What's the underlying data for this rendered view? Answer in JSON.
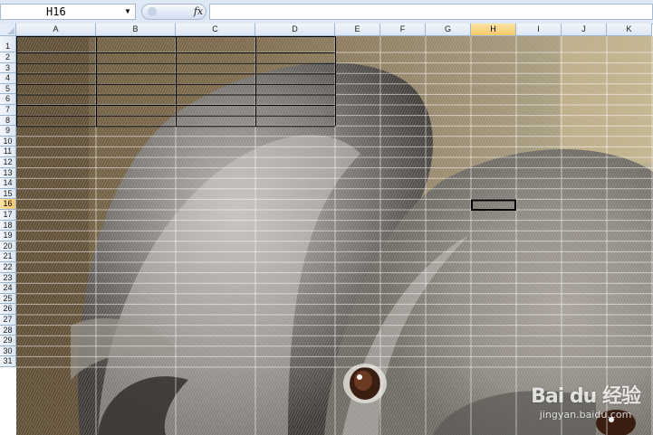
{
  "formula_bar": {
    "name_box_value": "H16",
    "fx_label": "fx",
    "formula_value": ""
  },
  "sheet": {
    "columns": [
      "A",
      "B",
      "C",
      "D",
      "E",
      "F",
      "G",
      "H",
      "I",
      "J",
      "K"
    ],
    "rows": [
      "1",
      "2",
      "3",
      "4",
      "5",
      "6",
      "7",
      "8",
      "9",
      "10",
      "11",
      "12",
      "13",
      "14",
      "15",
      "16",
      "17",
      "18",
      "19",
      "20",
      "21",
      "22",
      "23",
      "24",
      "25",
      "26",
      "27",
      "28",
      "29",
      "30",
      "31"
    ],
    "active_cell": {
      "column": "H",
      "row": "16"
    },
    "bordered_range": {
      "from": "A1",
      "to": "D8"
    },
    "background_picture": "koala photograph"
  },
  "watermark": {
    "logo_text": "Bai du 经验",
    "url_text": "jingyan.baidu.com"
  },
  "colors": {
    "header_bg": "#dbe5f2",
    "header_selected": "#f6c96a",
    "grid_line": "#ffffff",
    "border_line": "#000000"
  }
}
